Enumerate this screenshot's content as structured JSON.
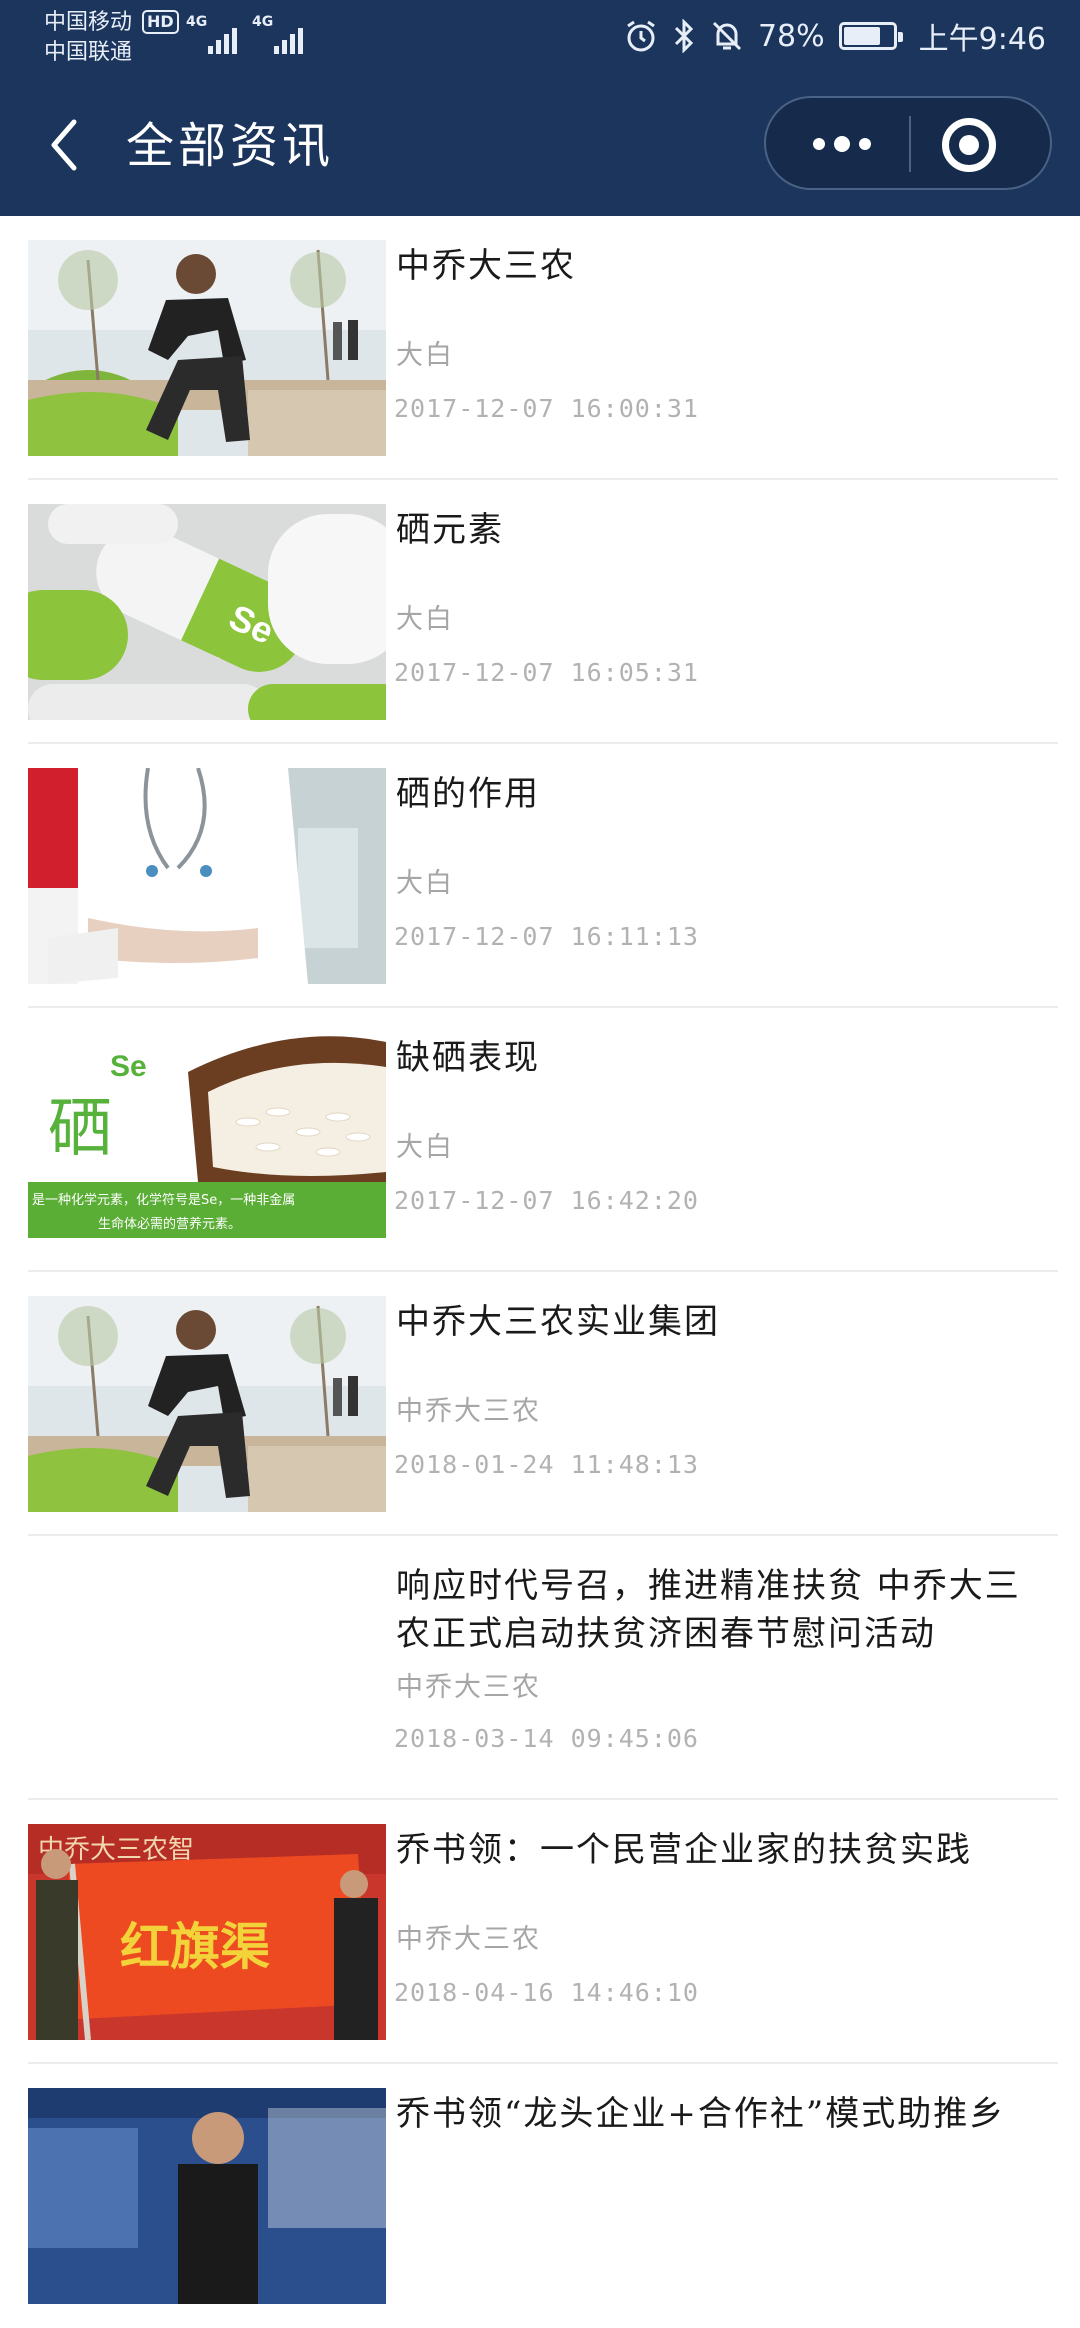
{
  "status_bar": {
    "carrier_1": "中国移动",
    "carrier_2": "中国联通",
    "hd_badge": "HD",
    "network_1": "4G",
    "network_2": "4G",
    "battery": "78%",
    "time": "上午9:46"
  },
  "nav": {
    "title": "全部资讯",
    "more_icon": "more-dots-icon",
    "close_icon": "target-circle-icon"
  },
  "news": [
    {
      "title": "中乔大三农",
      "author": "大白",
      "date": "2017-12-07 16:00:31",
      "thumb_icon": "man-crouching-photo"
    },
    {
      "title": "硒元素",
      "author": "大白",
      "date": "2017-12-07 16:05:31",
      "thumb_icon": "selenium-capsules-photo",
      "thumb_text": "Se"
    },
    {
      "title": "硒的作用",
      "author": "大白",
      "date": "2017-12-07 16:11:13",
      "thumb_icon": "doctor-stethoscope-photo"
    },
    {
      "title": "缺硒表现",
      "author": "大白",
      "date": "2017-12-07 16:42:20",
      "thumb_icon": "selenium-rice-photo",
      "thumb_big_char": "硒",
      "thumb_se": "Se",
      "thumb_caption_1": "是一种化学元素，化学符号是Se，一种非金属",
      "thumb_caption_2": "生命体必需的营养元素。"
    },
    {
      "title": "中乔大三农实业集团",
      "author": "中乔大三农",
      "date": "2018-01-24 11:48:13",
      "thumb_icon": "man-crouching-photo"
    },
    {
      "title": "响应时代号召，推进精准扶贫 中乔大三农正式启动扶贫济困春节慰问活动",
      "author": "中乔大三农",
      "date": "2018-03-14 09:45:06",
      "thumb_icon": "blank"
    },
    {
      "title": "乔书领：一个民营企业家的扶贫实践",
      "author": "中乔大三农",
      "date": "2018-04-16 14:46:10",
      "thumb_icon": "red-flag-photo",
      "thumb_flag_text": "红旗渠",
      "thumb_banner_text": "中乔大三农智"
    },
    {
      "title": "乔书领“龙头企业+合作社”模式助推乡",
      "author": "",
      "date": "",
      "thumb_icon": "news-broadcast-photo"
    }
  ],
  "colors": {
    "header_bg": "#1b355c",
    "title_text": "#1a1a1a",
    "meta_text": "#a6a6a6"
  }
}
